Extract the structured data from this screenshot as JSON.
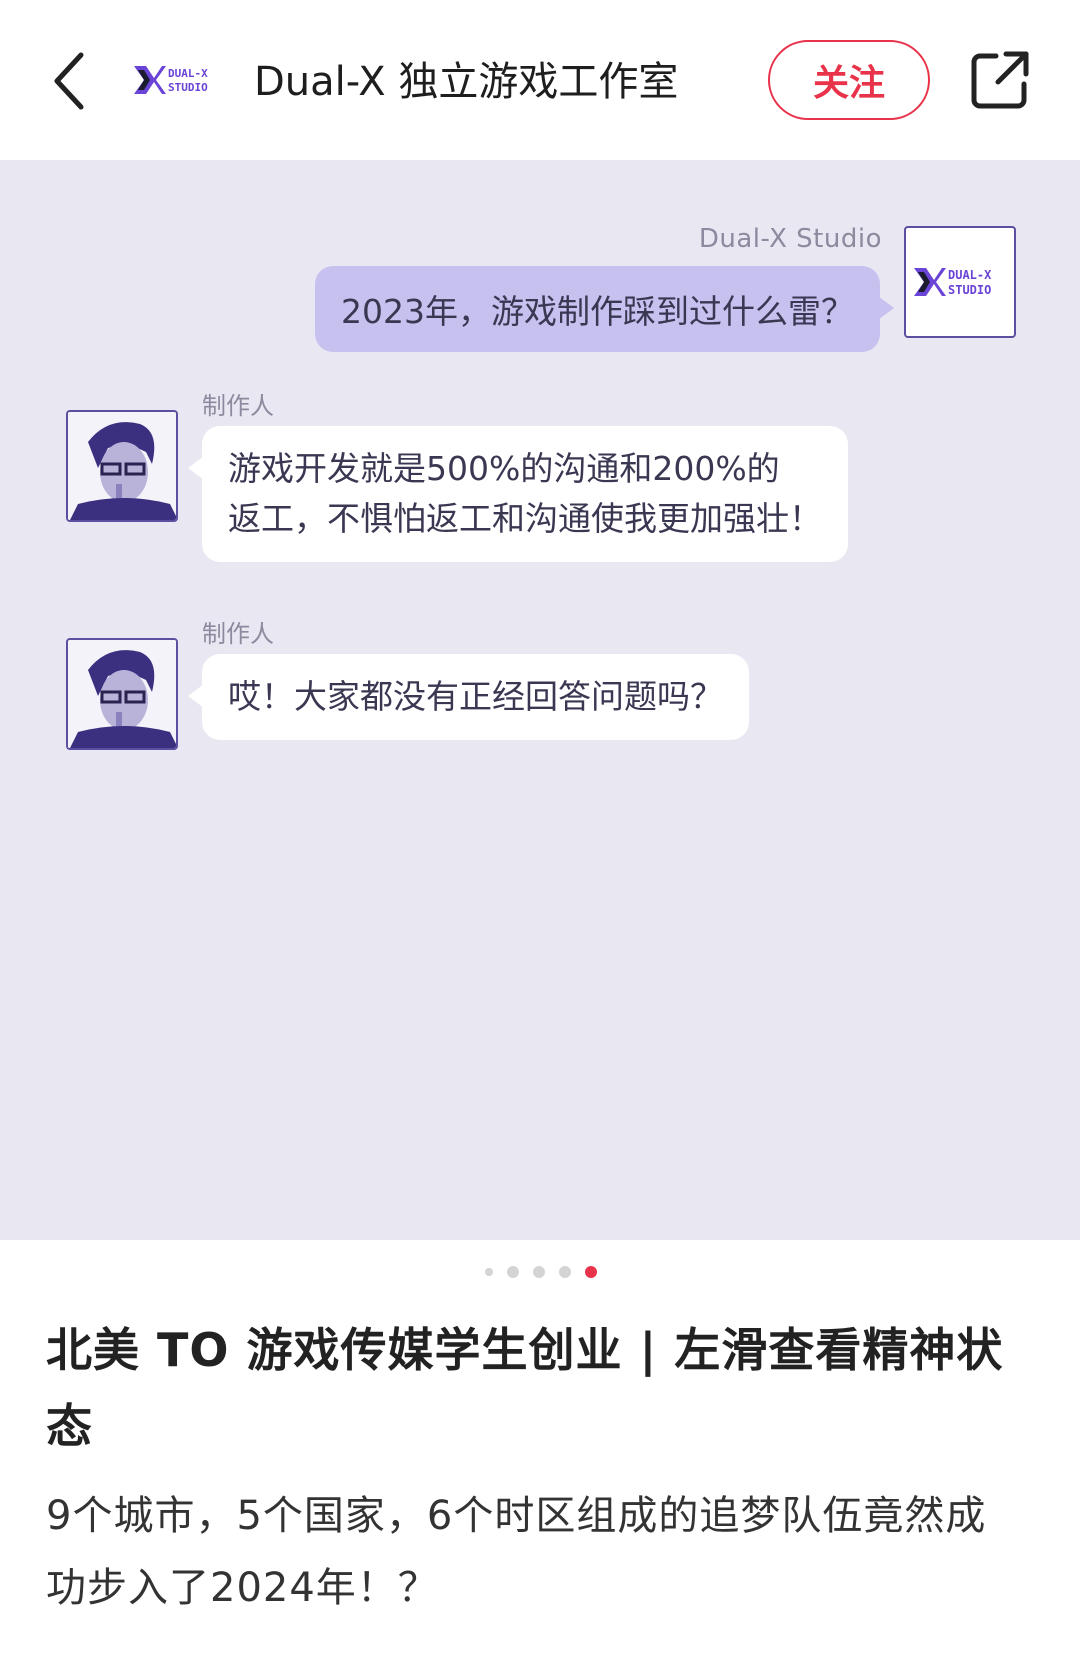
{
  "header": {
    "title": "Dual-X 独立游戏工作室",
    "follow_label": "关注",
    "logo_text_line1": "DUAL-X",
    "logo_text_line2": "STUDIO"
  },
  "chat": {
    "studio_name": "Dual-X Studio",
    "question": "2023年，游戏制作踩到过什么雷？",
    "messages": [
      {
        "sender": "制作人",
        "text_line1": "游戏开发就是500%的沟通和200%的",
        "text_line2": "返工，不惧怕返工和沟通使我更加强壮！"
      },
      {
        "sender": "制作人",
        "text_line1": "哎！大家都没有正经回答问题吗？"
      }
    ]
  },
  "pagination": {
    "total": 5,
    "active_index": 4
  },
  "post": {
    "title": "北美 TO 游戏传媒学生创业 | 左滑查看精神状态",
    "body": "9个城市，5个国家，6个时区组成的追梦队伍竟然成功步入了2024年！？"
  },
  "colors": {
    "accent": "#e8334a",
    "brand_purple": "#5a4fa0",
    "chat_bg": "#e9e8f2",
    "bubble_out": "#c7c1f0"
  },
  "icons": [
    "chevron-left-icon",
    "share-icon"
  ]
}
